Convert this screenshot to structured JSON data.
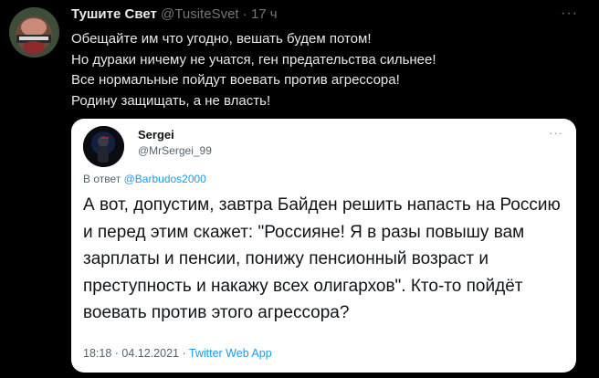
{
  "tweet": {
    "author_name": "Тушите Свет",
    "author_handle": "@TusiteSvet",
    "separator": "·",
    "time": "17 ч",
    "more": "···",
    "lines": [
      "Обещайте им что угодно, вешать будем потом!",
      "Но дураки ничему не учатся, ген предательства сильнее!",
      "Все нормальные пойдут воевать против агрессора!",
      "Родину защищать, а не власть!"
    ]
  },
  "quoted": {
    "author_name": "Sergei",
    "author_handle": "@MrSergei_99",
    "more": "···",
    "reply_prefix": "В ответ",
    "reply_mention": "@Barbudos2000",
    "lines": [
      "А вот, допустим, завтра Байден решить напасть на Россию",
      "и перед этим скажет: \"Россияне! Я в разы повышу вам",
      "зарплаты и пенсии, понижу пенсионный возраст и",
      "преступность и накажу всех олигархов\". Кто-то пойдёт",
      "воевать против этого агрессора?"
    ],
    "footer_time": "18:18",
    "footer_sep": "·",
    "footer_date": "04.12.2021",
    "footer_app": "Twitter Web App"
  },
  "colors": {
    "background": "#000000",
    "text": "#e7e9ea",
    "muted": "#71767b",
    "link": "#1d9bf0",
    "card": "#ffffff"
  }
}
